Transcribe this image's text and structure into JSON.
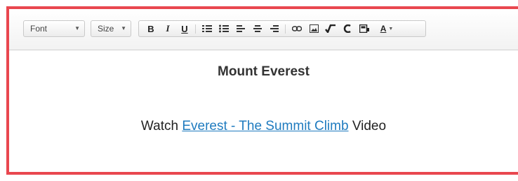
{
  "toolbar": {
    "font_label": "Font",
    "size_label": "Size",
    "buttons": {
      "bold": "B",
      "italic": "I",
      "underline": "U",
      "font_color": "A"
    }
  },
  "content": {
    "heading": "Mount Everest",
    "prefix": "Watch",
    "link_text": "Everest - The Summit Climb",
    "suffix": "Video"
  },
  "colors": {
    "frame_border": "#e9474f",
    "link": "#1f7bbf"
  },
  "icons": [
    "ordered-list-icon",
    "unordered-list-icon",
    "align-left-icon",
    "align-center-icon",
    "align-right-icon",
    "link-icon",
    "image-icon",
    "math-icon",
    "source-icon",
    "media-icon",
    "font-color-icon"
  ]
}
